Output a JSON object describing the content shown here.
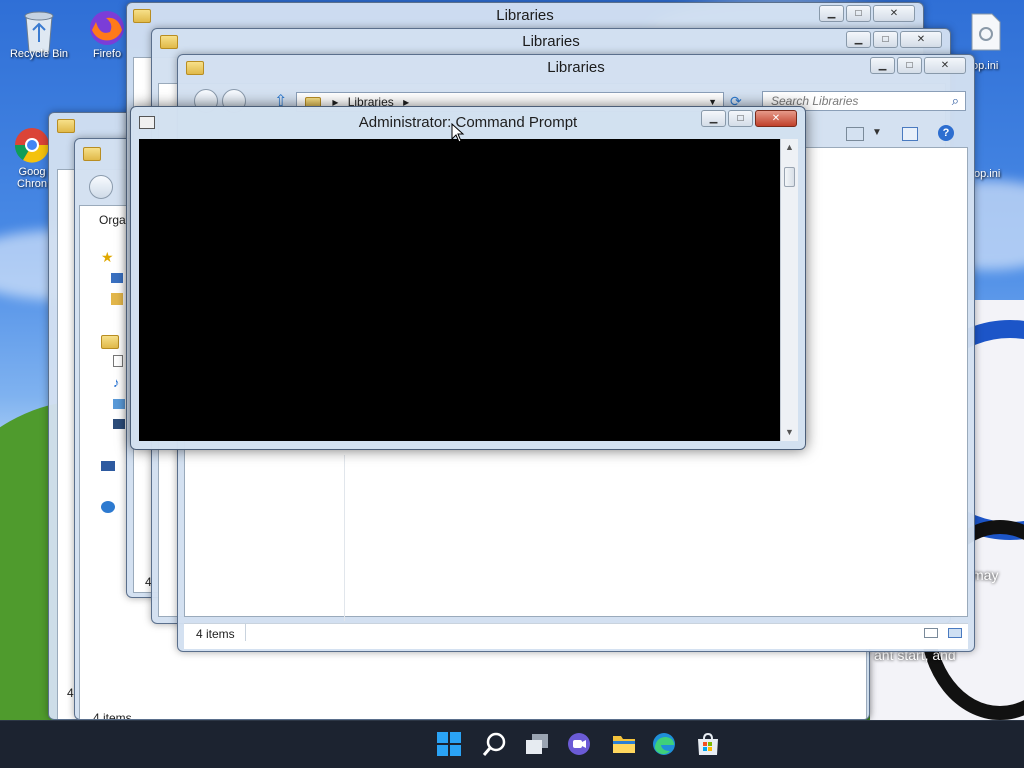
{
  "desktop": {
    "icons": [
      {
        "label": "Recycle Bin",
        "icon": "recycle-bin-icon"
      },
      {
        "label": "Firefo",
        "icon": "firefox-icon"
      },
      {
        "label": "Goog",
        "label2": "Chron",
        "icon": "chrome-icon"
      },
      {
        "label": "op.ini",
        "icon": "ini-file-icon"
      },
      {
        "label": "op.ini",
        "icon": "ini-file-icon"
      }
    ],
    "wallpaper_text": [
      "may",
      "ant start, and"
    ]
  },
  "windows": {
    "libraries_back1": {
      "title": "Libraries"
    },
    "libraries_back2": {
      "title": "Libraries"
    },
    "libraries_front": {
      "title": "Libraries",
      "address_path": "Libraries",
      "search_placeholder": "Search Libraries",
      "status": "4 items"
    },
    "explorer_left": {
      "organize_label": "Orga",
      "status_a": "4",
      "status_b": "4",
      "status_c": "4 items"
    }
  },
  "cmd": {
    "title": "Administrator: Command Prompt"
  },
  "taskbar": {
    "icons": [
      "start-icon",
      "search-icon",
      "task-view-icon",
      "chat-icon",
      "file-explorer-icon",
      "edge-icon",
      "store-icon"
    ]
  },
  "colors": {
    "accent": "#0078d4",
    "taskbar_bg": "#1c2330",
    "close_button": "#c0402a"
  }
}
